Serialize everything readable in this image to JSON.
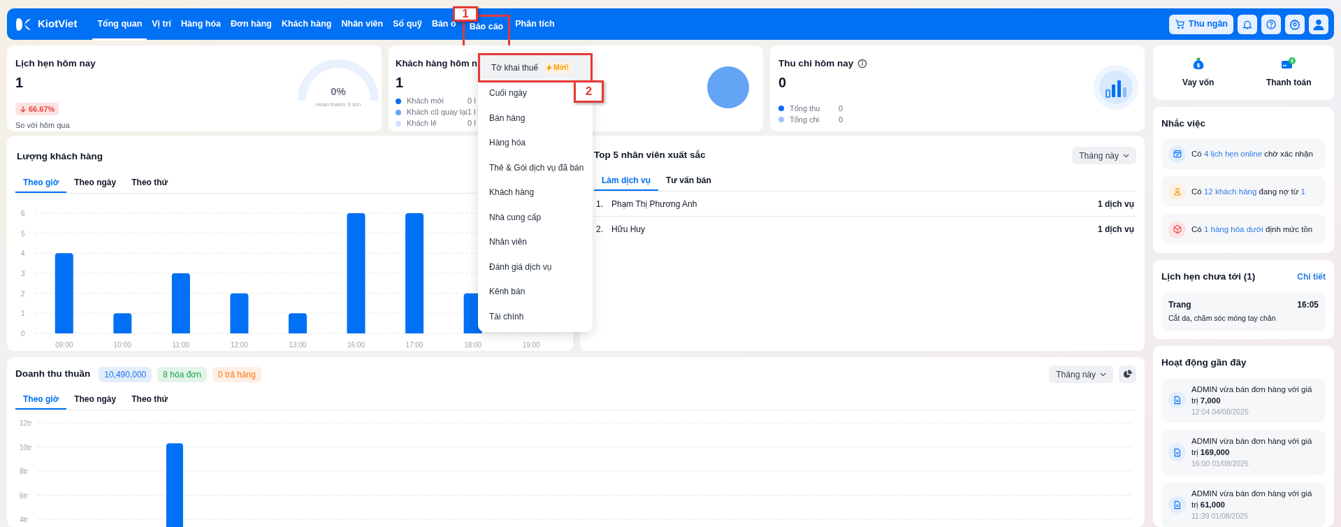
{
  "nav": {
    "logo": "KiotViet",
    "items": [
      {
        "label": "Tổng quan",
        "selected": true
      },
      {
        "label": "Vị trí",
        "selected": false
      },
      {
        "label": "Hàng hóa",
        "selected": false
      },
      {
        "label": "Đơn hàng",
        "selected": false
      },
      {
        "label": "Khách hàng",
        "selected": false
      },
      {
        "label": "Nhân viên",
        "selected": false
      },
      {
        "label": "Sổ quỹ",
        "selected": false
      },
      {
        "label": "Bán o",
        "selected": false
      },
      {
        "label": "Báo cáo",
        "selected": false
      },
      {
        "label": "Phân tích",
        "selected": false
      }
    ],
    "cashier_button": "Thu ngân"
  },
  "report_menu": {
    "items": [
      {
        "label": "Tờ khai thuế",
        "badge": "Mới!",
        "highlighted": true
      },
      {
        "label": "Cuối ngày",
        "highlighted": false
      },
      {
        "label": "Bán hàng",
        "highlighted": false
      },
      {
        "label": "Hàng hóa",
        "highlighted": false
      },
      {
        "label": "Thẻ & Gói dịch vụ đã bán",
        "highlighted": false
      },
      {
        "label": "Khách hàng",
        "highlighted": false
      },
      {
        "label": "Nhà cung cấp",
        "highlighted": false
      },
      {
        "label": "Nhân viên",
        "highlighted": false
      },
      {
        "label": "Đánh giá dịch vụ",
        "highlighted": false
      },
      {
        "label": "Kênh bán",
        "highlighted": false
      },
      {
        "label": "Tài chính",
        "highlighted": false
      }
    ]
  },
  "annotations": [
    {
      "label": "1"
    },
    {
      "label": "2"
    }
  ],
  "appointments_today": {
    "title": "Lịch hẹn hôm nay",
    "value": "1",
    "change": "66.67%",
    "compare": "So với hôm qua",
    "gauge_value": "0%",
    "gauge_caption": "Hoàn thành: 0 lịch"
  },
  "customers_today": {
    "title": "Khách hàng hôm n",
    "value": "1",
    "legend": [
      {
        "label": "Khách mới",
        "value": "0 l",
        "color": "#0a6ef5"
      },
      {
        "label": "Khách cũ quay lại",
        "value": "1 l",
        "color": "#65a6f7"
      },
      {
        "label": "Khách lẻ",
        "value": "0 l",
        "color": "#cfe2fc"
      }
    ]
  },
  "cashflow_today": {
    "title": "Thu chi hôm nay",
    "value": "0",
    "legend": [
      {
        "label": "Tổng thu",
        "value": "0",
        "color": "#0a6ef5"
      },
      {
        "label": "Tổng chi",
        "value": "0",
        "color": "#9cc6fa"
      }
    ]
  },
  "quick_actions": [
    {
      "kind": "loan",
      "label": "Vay vốn"
    },
    {
      "kind": "payment",
      "label": "Thanh toán"
    }
  ],
  "customer_traffic": {
    "title": "Lượng khách hàng",
    "tabs": [
      {
        "label": "Theo giờ",
        "selected": true
      },
      {
        "label": "Theo ngày",
        "selected": false
      },
      {
        "label": "Theo thứ",
        "selected": false
      }
    ],
    "chart_data": {
      "type": "bar",
      "categories": [
        "09:00",
        "10:00",
        "11:00",
        "12:00",
        "13:00",
        "16:00",
        "17:00",
        "18:00",
        "19:00"
      ],
      "series": [
        {
          "color": "#0070f4",
          "values": [
            4,
            1,
            3,
            2,
            1,
            6,
            6,
            2,
            null
          ]
        }
      ],
      "ylim": [
        0,
        6
      ],
      "yticks": [
        0,
        1,
        2,
        3,
        4,
        5,
        6
      ],
      "grid": true
    }
  },
  "top_staff": {
    "title": "Top 5 nhân viên xuất sắc",
    "period": "Tháng này",
    "tabs": [
      {
        "label": "Làm dịch vụ",
        "selected": true
      },
      {
        "label": "Tư vấn bán",
        "selected": false
      }
    ],
    "rows": [
      {
        "rank": "1.",
        "name": "Phạm Thị Phương Anh",
        "count": "1 dịch vụ"
      },
      {
        "rank": "2.",
        "name": "Hữu Huy",
        "count": "1 dịch vụ"
      }
    ]
  },
  "revenue": {
    "title": "Doanh thu thuần",
    "badges": [
      {
        "text": "10,490,000",
        "color": "#1a73e8"
      },
      {
        "text": "8 hóa đơn",
        "color": "#16a34a"
      },
      {
        "text": "0 trả hàng",
        "color": "#f97316"
      }
    ],
    "period": "Tháng này",
    "tabs": [
      {
        "label": "Theo giờ",
        "selected": true
      },
      {
        "label": "Theo ngày",
        "selected": false
      },
      {
        "label": "Theo thứ",
        "selected": false
      }
    ],
    "chart_data": {
      "type": "bar",
      "series": [
        {
          "color": "#0070f4",
          "values": [
            null,
            10.3,
            null,
            null,
            null,
            null,
            null,
            null,
            null,
            null,
            null,
            null
          ]
        }
      ],
      "ylim": [
        0,
        12
      ],
      "yticks": [
        {
          "value": 4,
          "label": "4tr"
        },
        {
          "value": 6,
          "label": "6tr"
        },
        {
          "value": 8,
          "label": "8tr"
        },
        {
          "value": 10,
          "label": "10tr"
        },
        {
          "value": 12,
          "label": "12tr"
        }
      ],
      "grid": true
    }
  },
  "reminders": {
    "title": "Nhắc việc",
    "items": [
      {
        "kind": "calendar",
        "parts": [
          {
            "text": "Có ",
            "link": false
          },
          {
            "text": "4 lịch hẹn online",
            "link": true
          },
          {
            "text": " chờ xác nhận",
            "link": false
          }
        ]
      },
      {
        "kind": "person",
        "parts": [
          {
            "text": "Có ",
            "link": false
          },
          {
            "text": "12 khách hàng",
            "link": true
          },
          {
            "text": " đang nợ từ ",
            "link": false
          },
          {
            "text": "1",
            "link": true
          }
        ]
      },
      {
        "kind": "box",
        "parts": [
          {
            "text": "Có ",
            "link": false
          },
          {
            "text": "1 hàng hóa dưới",
            "link": true
          },
          {
            "text": " định mức tồn",
            "link": false
          }
        ]
      }
    ]
  },
  "upcoming": {
    "title": "Lịch hẹn chưa tới (1)",
    "detail_link": "Chi tiết",
    "items": [
      {
        "name": "Trang",
        "time": "16:05",
        "service": "Cắt da, chăm sóc móng tay chân"
      }
    ]
  },
  "activity": {
    "title": "Hoạt động gần đây",
    "items": [
      {
        "text": "ADMIN vừa bán đơn hàng với giá trị **7,000**",
        "time": "12:04 04/08/2025"
      },
      {
        "text": "ADMIN vừa bán đơn hàng với giá trị **169,000**",
        "time": "16:00 01/08/2025"
      },
      {
        "text": "ADMIN vừa bán đơn hàng với giá trị **61,000**",
        "time": "11:39 01/08/2025"
      }
    ]
  }
}
